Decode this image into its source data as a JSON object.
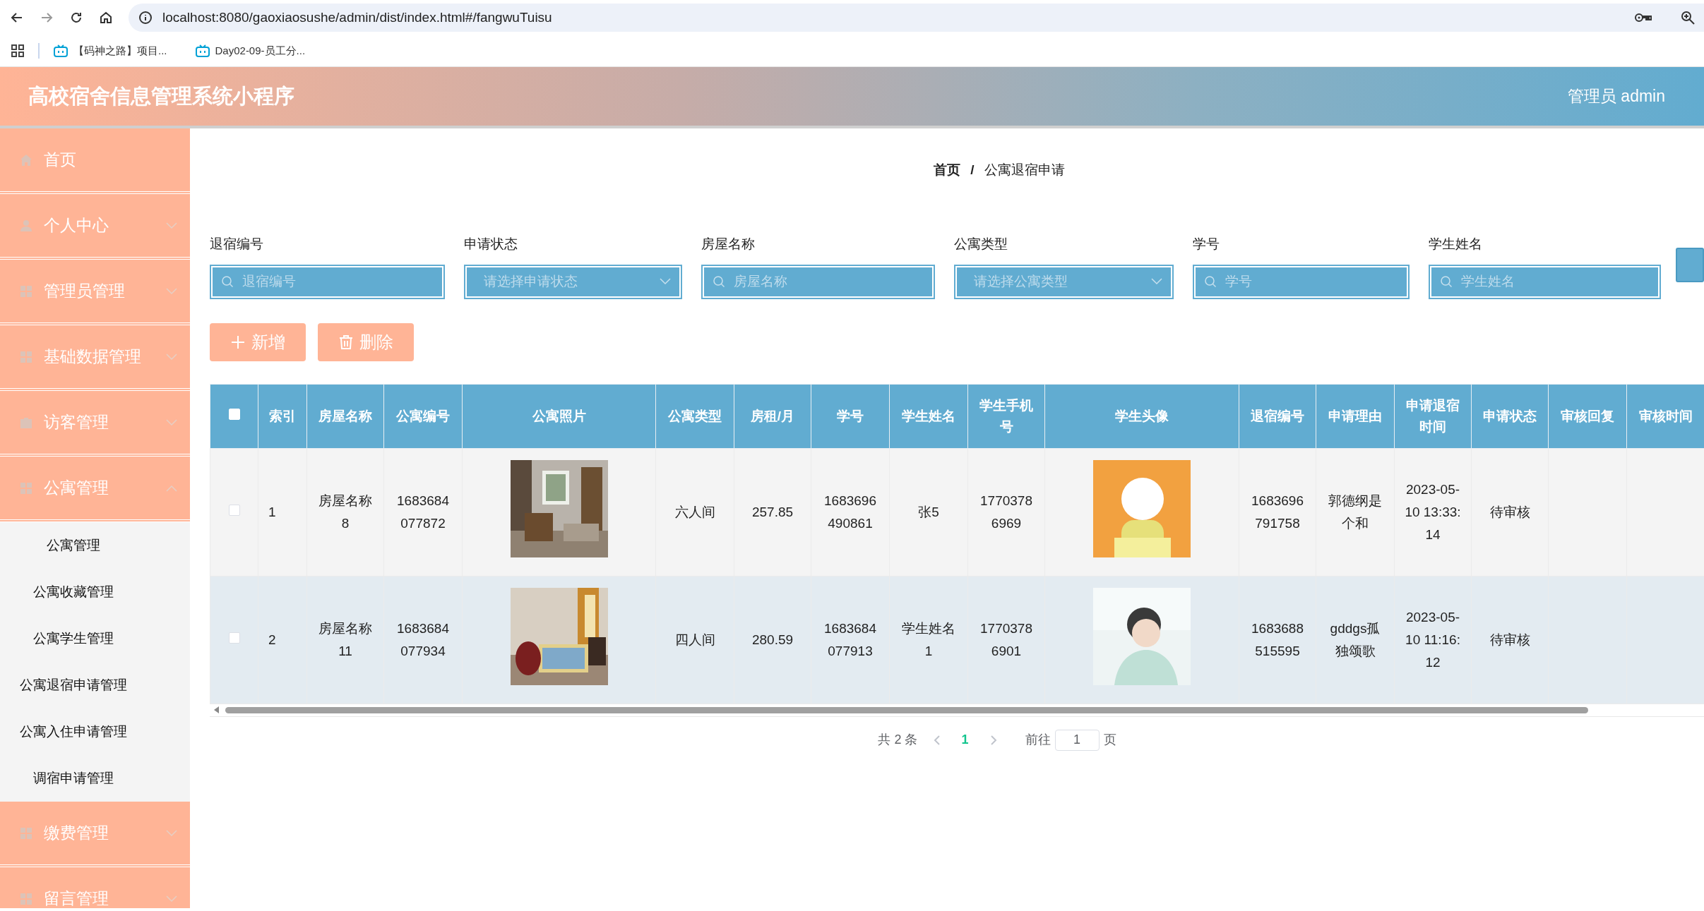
{
  "browser": {
    "url": "localhost:8080/gaoxiaosushe/admin/dist/index.html#/fangwuTuisu",
    "bookmarks": [
      "【码神之路】项目...",
      "Day02-09-员工分..."
    ]
  },
  "header": {
    "title": "高校宿舍信息管理系统小程序",
    "user": "管理员 admin"
  },
  "sidebar": {
    "items": [
      {
        "label": "首页",
        "kind": "home"
      },
      {
        "label": "个人中心",
        "kind": "user",
        "expanded": false
      },
      {
        "label": "管理员管理",
        "kind": "grid",
        "expanded": false
      },
      {
        "label": "基础数据管理",
        "kind": "grid",
        "expanded": false
      },
      {
        "label": "访客管理",
        "kind": "briefcase",
        "expanded": false
      },
      {
        "label": "公寓管理",
        "kind": "grid",
        "expanded": true,
        "children": [
          "公寓管理",
          "公寓收藏管理",
          "公寓学生管理",
          "公寓退宿申请管理",
          "公寓入住申请管理",
          "调宿申请管理"
        ]
      },
      {
        "label": "缴费管理",
        "kind": "grid",
        "expanded": false
      },
      {
        "label": "留言管理",
        "kind": "grid",
        "expanded": false
      }
    ]
  },
  "breadcrumb": {
    "items": [
      "首页",
      "公寓退宿申请"
    ],
    "separator": "/"
  },
  "filters": [
    {
      "label": "退宿编号",
      "placeholder": "退宿编号",
      "kind": "text"
    },
    {
      "label": "申请状态",
      "placeholder": "请选择申请状态",
      "kind": "select"
    },
    {
      "label": "房屋名称",
      "placeholder": "房屋名称",
      "kind": "text"
    },
    {
      "label": "公寓类型",
      "placeholder": "请选择公寓类型",
      "kind": "select"
    },
    {
      "label": "学号",
      "placeholder": "学号",
      "kind": "text"
    },
    {
      "label": "学生姓名",
      "placeholder": "学生姓名",
      "kind": "text"
    }
  ],
  "actions": [
    {
      "label": "新增",
      "kind": "add"
    },
    {
      "label": "删除",
      "kind": "delete"
    }
  ],
  "table": {
    "all_checked": false,
    "columns": [
      {
        "label": "索引",
        "kind": "text"
      },
      {
        "label": "房屋名称",
        "kind": "text"
      },
      {
        "label": "公寓编号",
        "kind": "text"
      },
      {
        "label": "公寓照片",
        "kind": "picture"
      },
      {
        "label": "公寓类型",
        "kind": "text"
      },
      {
        "label": "房租/月",
        "kind": "text"
      },
      {
        "label": "学号",
        "kind": "text"
      },
      {
        "label": "学生姓名",
        "kind": "text"
      },
      {
        "label": "学生手机号",
        "kind": "text"
      },
      {
        "label": "学生头像",
        "kind": "picture"
      },
      {
        "label": "退宿编号",
        "kind": "text"
      },
      {
        "label": "申请理由",
        "kind": "text"
      },
      {
        "label": "申请退宿时间",
        "kind": "text"
      },
      {
        "label": "申请状态",
        "kind": "text"
      },
      {
        "label": "审核回复",
        "kind": "text"
      },
      {
        "label": "审核时间",
        "kind": "text"
      }
    ],
    "rows": [
      {
        "checked": false,
        "hovered": false,
        "cells": [
          "1",
          "房屋名称8",
          "1683684077872",
          {
            "kind": "picture"
          },
          "六人间",
          "257.85",
          "1683696490861",
          "张5",
          "17703786969",
          {
            "kind": "picture"
          },
          "1683696791758",
          "郭德纲是个和",
          "2023-05-10 13:33:14",
          "待审核"
        ]
      },
      {
        "checked": false,
        "hovered": true,
        "cells": [
          "2",
          "房屋名称11",
          "1683684077934",
          {
            "kind": "picture"
          },
          "四人间",
          "280.59",
          "1683684077913",
          "学生姓名1",
          "17703786901",
          {
            "kind": "picture"
          },
          "1683688515595",
          "gddgs孤独颂歌",
          "2023-05-10 11:16:12",
          "待审核"
        ]
      }
    ]
  },
  "pagination": {
    "total": "共 2 条",
    "pages": [
      {
        "label": "1",
        "selected": true
      }
    ],
    "goto_label": "前往",
    "goto_value": "1",
    "page_suffix": "页"
  }
}
